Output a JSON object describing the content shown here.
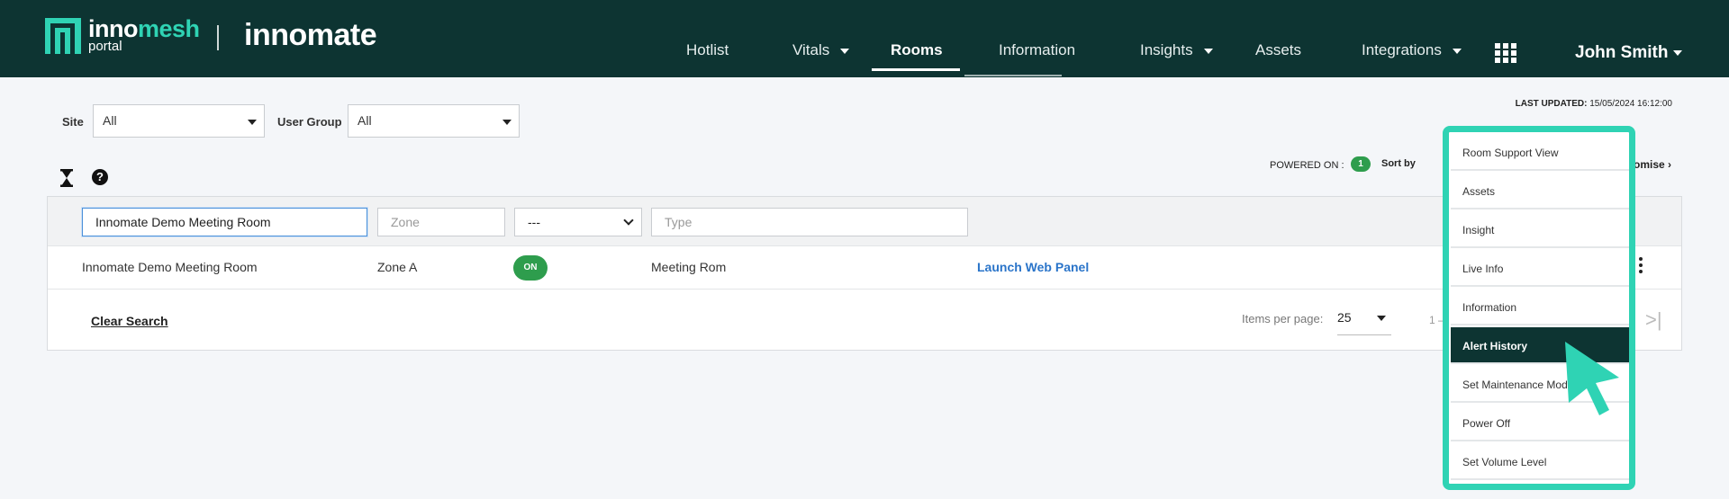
{
  "header": {
    "logo_word": "innomesh",
    "logo_word_a": "inno",
    "logo_word_b": "mesh",
    "logo_sub": "portal",
    "brand": "innomate",
    "nav": [
      {
        "label": "Hotlist",
        "dropdown": false
      },
      {
        "label": "Vitals",
        "dropdown": true
      },
      {
        "label": "Rooms",
        "dropdown": false,
        "active": true
      },
      {
        "label": "Information",
        "dropdown": false
      },
      {
        "label": "Insights",
        "dropdown": true
      },
      {
        "label": "Assets",
        "dropdown": false
      },
      {
        "label": "Integrations",
        "dropdown": true
      }
    ],
    "user": "John Smith",
    "bg_color": "#0d3432",
    "accent": "#2fd3b4"
  },
  "filters": {
    "site_label": "Site",
    "site_value": "All",
    "group_label": "User Group",
    "group_value": "All",
    "last_updated_label": "LAST UPDATED:",
    "last_updated_value": "15/05/2024 16:12:00"
  },
  "toolbar": {
    "powered_label": "POWERED ON :",
    "powered_count": "1",
    "sort_label": "Sort by",
    "customise": "omise"
  },
  "table": {
    "filters": {
      "name_value": "Innomate Demo Meeting Room",
      "zone_placeholder": "Zone",
      "status_value": "---",
      "type_placeholder": "Type"
    },
    "rows": [
      {
        "name": "Innomate Demo Meeting Room",
        "zone": "Zone A",
        "status": "ON",
        "type": "Meeting Rom",
        "action": "Launch Web Panel"
      }
    ],
    "clear_search": "Clear Search",
    "items_per_page_label": "Items per page:",
    "items_per_page_value": "25",
    "range": "1 –",
    "last_page_glyph": ">|"
  },
  "menu": {
    "items": [
      {
        "label": "Room Support View"
      },
      {
        "label": "Assets"
      },
      {
        "label": "Insight"
      },
      {
        "label": "Live Info"
      },
      {
        "label": "Information"
      },
      {
        "label": "Alert History",
        "selected": true
      },
      {
        "label": "Set Maintenance Mode"
      },
      {
        "label": "Power Off"
      },
      {
        "label": "Set Volume Level"
      }
    ]
  }
}
